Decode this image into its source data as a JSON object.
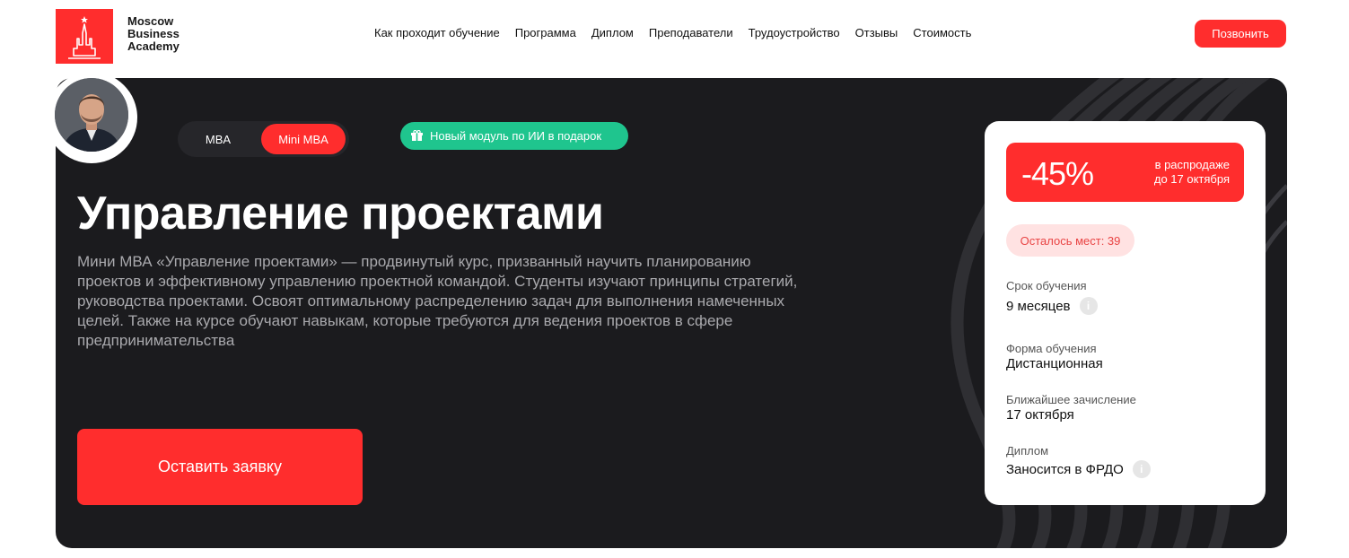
{
  "logo": {
    "line1": "Moscow",
    "line2": "Business",
    "line3": "Academy"
  },
  "nav": [
    "Как проходит обучение",
    "Программа",
    "Диплом",
    "Преподаватели",
    "Трудоустройство",
    "Отзывы",
    "Стоимость"
  ],
  "call_button": "Позвонить",
  "toggle": {
    "options": [
      "MBA",
      "Mini MBA"
    ],
    "selected": "Mini MBA"
  },
  "promo_badge": "Новый модуль по ИИ в подарок",
  "title": "Управление проектами",
  "description_lines": [
    "Мини МВА «Управление проектами» — продвинутый курс, призванный научить планированию",
    "проектов и эффективному управлению проектной командой. Студенты изучают принципы стратегий,",
    "руководства проектами. Освоят оптимальному распределению задач для выполнения намеченных",
    "целей. Также на курсе обучают навыкам, которые требуются для ведения проектов в сфере",
    "предпринимательства"
  ],
  "apply_button": "Оставить заявку",
  "card": {
    "discount": "-45%",
    "sale_line1": "в распродаже",
    "sale_line2": "до 17 октября",
    "seats": "Осталось мест: 39",
    "items": [
      {
        "label": "Срок обучения",
        "value": "9 месяцев",
        "info": true
      },
      {
        "label": "Форма обучения",
        "value": "Дистанционная",
        "info": false
      },
      {
        "label": "Ближайшее зачисление",
        "value": "17 октября",
        "info": false
      },
      {
        "label": "Диплом",
        "value": "Заносится в ФРДО",
        "info": true
      }
    ]
  },
  "colors": {
    "accent": "#ff2d2d",
    "hero_bg": "#1b1b1e",
    "promo_green": "#1fc58e",
    "seats_bg": "#ffe2e2"
  }
}
